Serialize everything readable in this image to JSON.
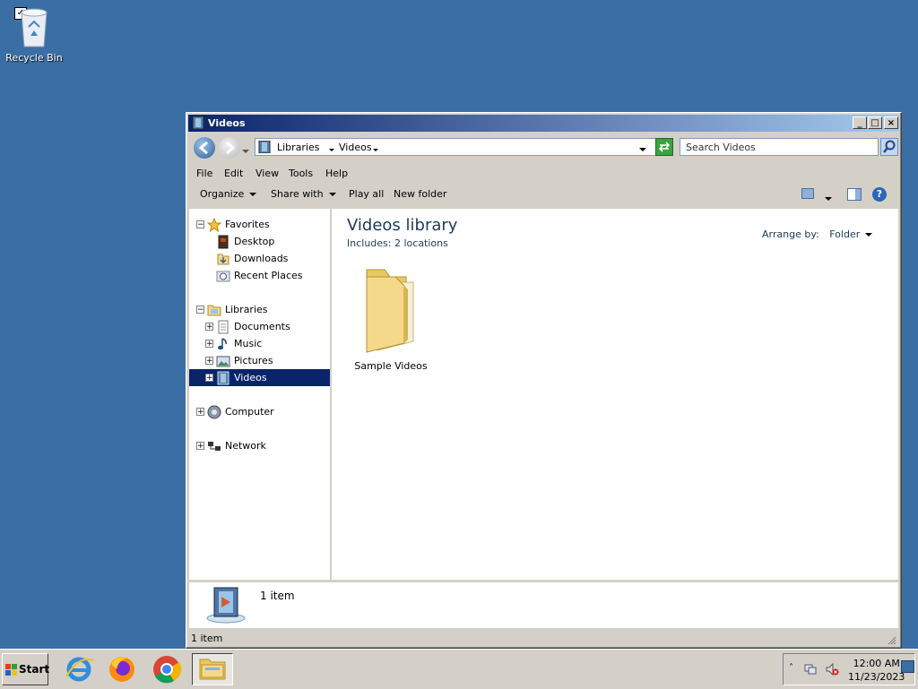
{
  "desktop": {
    "recycle_bin_label": "Recycle Bin"
  },
  "window": {
    "title": "Videos",
    "address": {
      "crumbs": [
        "Libraries",
        "Videos"
      ]
    },
    "search_placeholder": "Search Videos",
    "menu": [
      "File",
      "Edit",
      "View",
      "Tools",
      "Help"
    ],
    "commands": {
      "organize": "Organize",
      "share_with": "Share with",
      "play_all": "Play all",
      "new_folder": "New folder"
    },
    "nav": {
      "favorites": "Favorites",
      "desktop": "Desktop",
      "downloads": "Downloads",
      "recent_places": "Recent Places",
      "libraries": "Libraries",
      "documents": "Documents",
      "music": "Music",
      "pictures": "Pictures",
      "videos": "Videos",
      "computer": "Computer",
      "network": "Network"
    },
    "content": {
      "library_title": "Videos library",
      "includes_label": "Includes:",
      "includes_value": "2 locations",
      "arrange_label": "Arrange by:",
      "arrange_value": "Folder",
      "items": [
        "Sample Videos"
      ]
    },
    "details_text": "1 item",
    "status_text": "1 item"
  },
  "taskbar": {
    "start_label": "Start",
    "time": "12:00 AM",
    "date": "11/23/2023"
  }
}
